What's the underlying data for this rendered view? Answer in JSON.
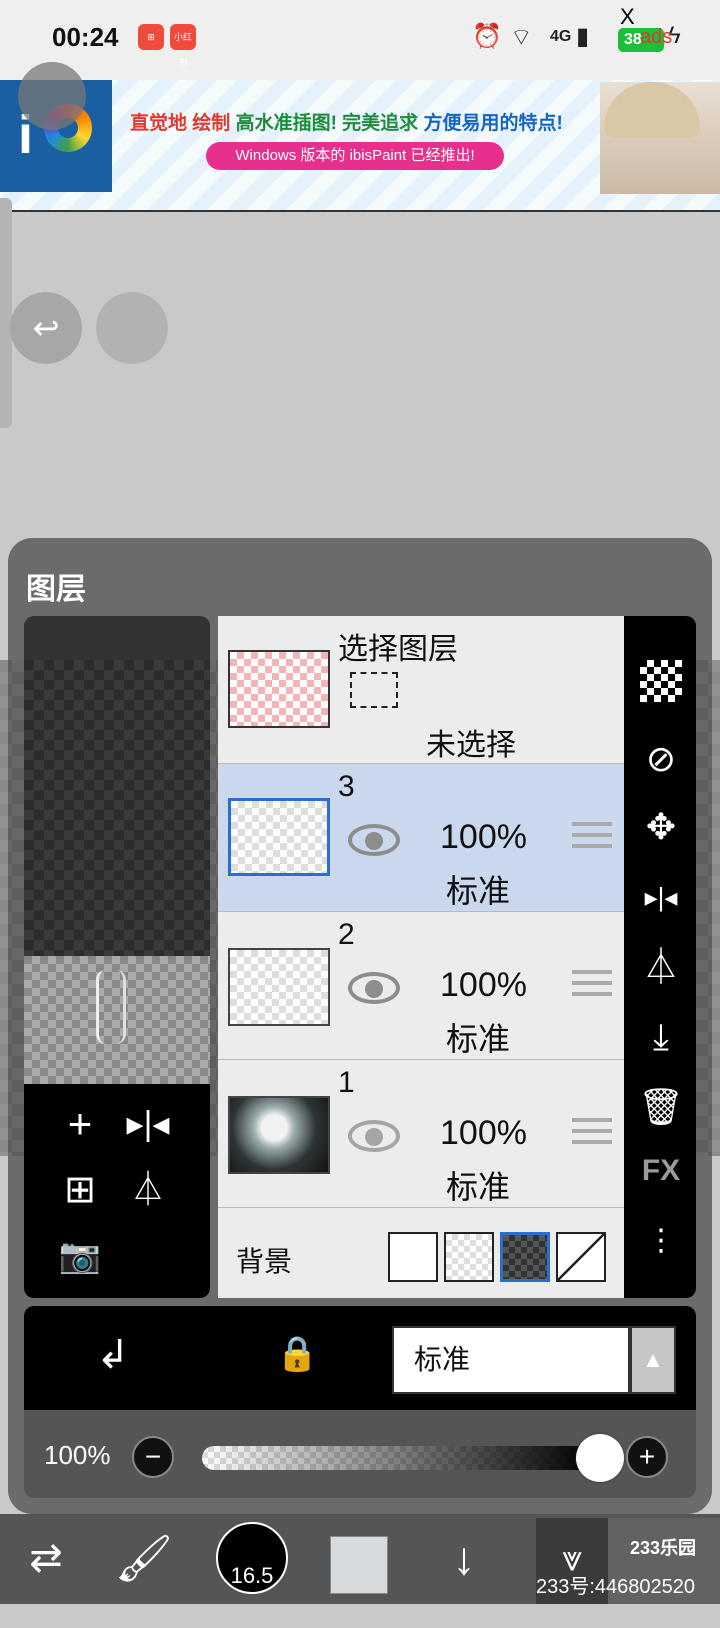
{
  "status_bar": {
    "time": "00:24",
    "app_icon_label": "小红书",
    "network": "4G",
    "battery": "38",
    "close_label": "X",
    "ad_label": "ads"
  },
  "ad": {
    "line1_part1": "直觉地 ",
    "line1_part2": "绘制",
    "line1_part3": " 高水准插图! 完美追求 ",
    "line1_part4": "方便易用的特点!",
    "line2": "Windows 版本的 ibisPaint 已经推出!",
    "logo_text": "i"
  },
  "panel": {
    "title": "图层",
    "selection_layer": {
      "title": "选择图层",
      "status": "未选择"
    },
    "layers": [
      {
        "number": "3",
        "opacity": "100%",
        "blend": "标准",
        "active": true
      },
      {
        "number": "2",
        "opacity": "100%",
        "blend": "标准",
        "active": false
      },
      {
        "number": "1",
        "opacity": "100%",
        "blend": "标准",
        "active": false
      }
    ],
    "background_label": "背景",
    "blend_mode": "标准",
    "opacity_label": "100%",
    "opacity_value": 1.0,
    "fx_label": "FX"
  },
  "toolbar": {
    "brush_size": "16.5"
  },
  "watermark": {
    "logo": "233乐园",
    "id": "233号:446802520"
  },
  "colors": {
    "active_layer": "#cad8ee",
    "active_border": "#2a6fcf",
    "ad_pill": "#e7308d"
  }
}
